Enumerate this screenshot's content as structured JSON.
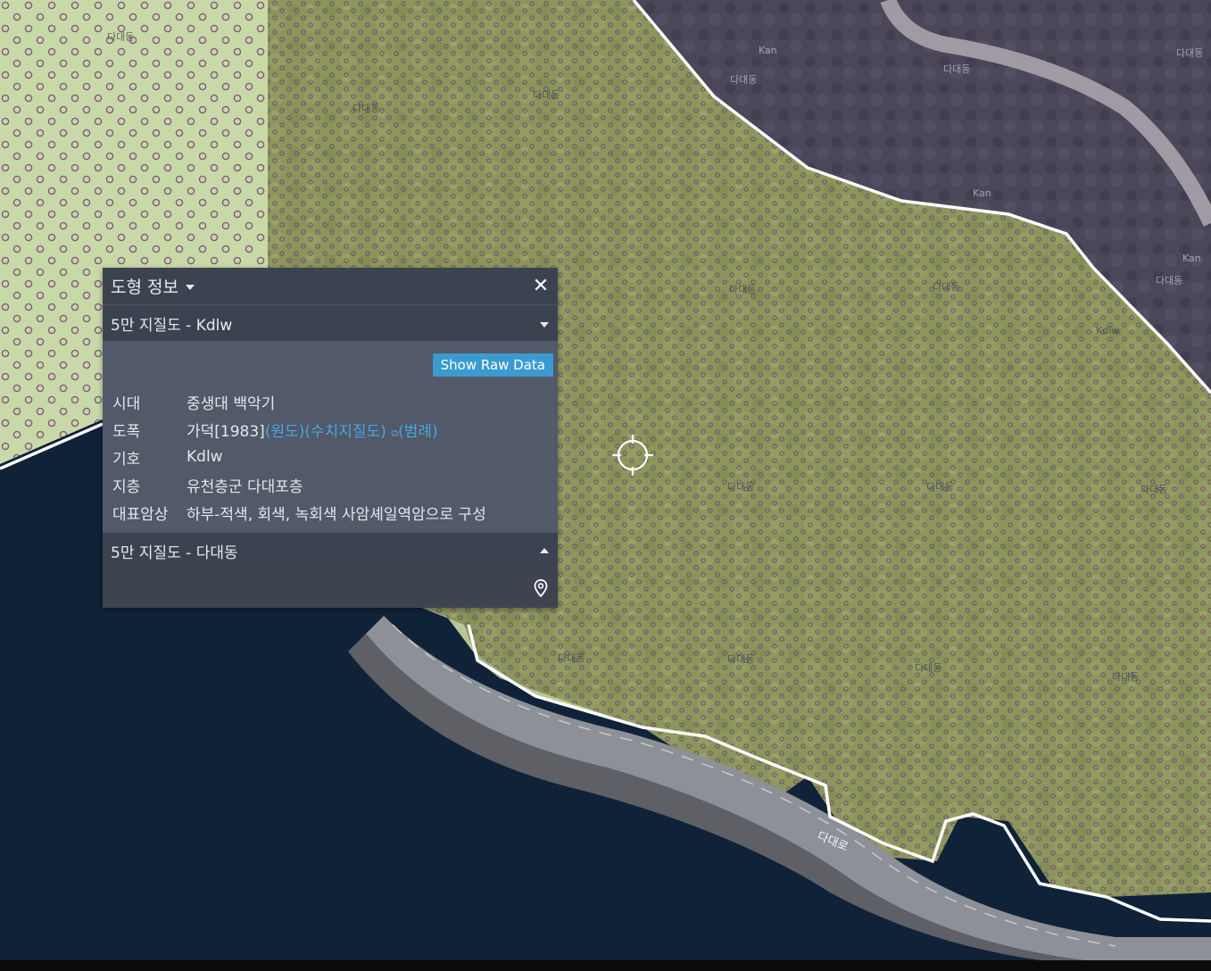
{
  "panel": {
    "title": "도형 정보",
    "close_icon": "close-icon",
    "section1": {
      "title": "5만 지질도 - Kdlw",
      "raw_button": "Show Raw Data",
      "rows": [
        {
          "key": "시대",
          "value": "중생대 백악기"
        },
        {
          "key": "도폭",
          "value": "가덕[1983]",
          "links": [
            "(원도)",
            "(수치지질도)",
            "(범례)"
          ]
        },
        {
          "key": "기호",
          "value": "Kdlw"
        },
        {
          "key": "지층",
          "value": "유천층군 다대포층"
        },
        {
          "key": "대표암상",
          "value": "하부-적색, 회색, 녹회색 사암셰일역암으로 구성"
        }
      ]
    },
    "section2": {
      "title": "5만 지질도 - 다대동",
      "pin_icon": "map-pin-icon"
    }
  },
  "map": {
    "labels": [
      "다대동",
      "Kan",
      "Kdlw",
      "다대로"
    ],
    "colors": {
      "sea": "#0f2238",
      "forest": "#8f9a5f",
      "pale_zone": "#c9dcae",
      "mountain": "#4a4558",
      "boundary": "#ffffff"
    },
    "crosshair_icon": "crosshair-icon"
  }
}
